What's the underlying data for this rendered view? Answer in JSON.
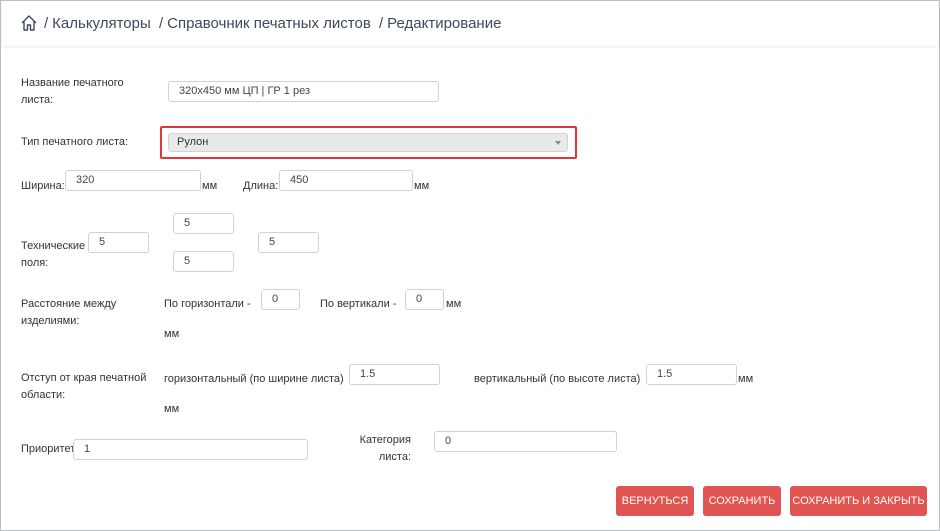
{
  "breadcrumb": {
    "items": [
      "Калькуляторы",
      "Справочник печатных листов",
      "Редактирование"
    ]
  },
  "form": {
    "name_label_1": "Название печатного",
    "name_label_2": "листа:",
    "name_value": "320х450 мм ЦП | ГР 1 рез",
    "type_label": "Тип печатного листа:",
    "type_value": "Рулон",
    "width_label": "Ширина:",
    "width_value": "320",
    "width_unit": "мм",
    "length_label": "Длина:",
    "length_value": "450",
    "length_unit": "мм",
    "tech_label_1": "Технические",
    "tech_label_2": "поля:",
    "tech_top": "5",
    "tech_left": "5",
    "tech_right": "5",
    "tech_bottom": "5",
    "distance_label_1": "Расстояние между",
    "distance_label_2": "изделиями:",
    "horiz_label": "По горизонтали -",
    "horiz_value": "0",
    "vert_label": "По вертикали -",
    "vert_value": "0",
    "distance_unit_1": "мм",
    "distance_unit_2": "мм",
    "offset_label_1": "Отступ от края печатной",
    "offset_label_2": "области:",
    "offset_h_label": "горизонтальный (по ширине листа)",
    "offset_h_value": "1.5",
    "offset_v_label": "вертикальный (по высоте листа)",
    "offset_v_value": "1.5",
    "offset_unit_1": "мм",
    "offset_unit_2": "мм",
    "priority_label": "Приоритет",
    "priority_value": "1",
    "category_label_1": "Категория",
    "category_label_2": "листа:",
    "category_value": "0"
  },
  "buttons": {
    "back": "ВЕРНУТЬСЯ",
    "save": "СОХРАНИТЬ",
    "save_close": "СОХРАНИТЬ И ЗАКРЫТЬ"
  },
  "colors": {
    "accent": "#e05451",
    "highlight": "#e2353b",
    "breadcrumb": "#3d4a5c"
  }
}
